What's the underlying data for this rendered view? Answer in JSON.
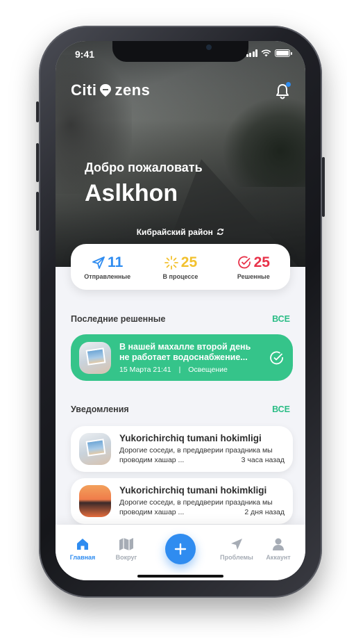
{
  "status": {
    "time": "9:41"
  },
  "header": {
    "logo_left": "Citi",
    "logo_right": "zens"
  },
  "hero": {
    "welcome": "Добро пожаловать",
    "username": "Aslkhon",
    "district": "Кибрайский район"
  },
  "stats": [
    {
      "value": "11",
      "label": "Отправленные",
      "color": "#2f8cf0",
      "icon": "paper-plane-icon"
    },
    {
      "value": "25",
      "label": "В процессе",
      "color": "#f2c12e",
      "icon": "loading-sun-icon"
    },
    {
      "value": "25",
      "label": "Решенные",
      "color": "#e8334a",
      "icon": "check-circle-icon"
    }
  ],
  "recent": {
    "title": "Последние решенные",
    "all": "ВСЕ",
    "card": {
      "title_line1": "В нашей махалле второй день",
      "title_line2": "не работает водоснабжение...",
      "date": "15 Марта 21:41",
      "separator": "|",
      "category": "Освещение"
    }
  },
  "notifications": {
    "title": "Уведомления",
    "all": "ВСЕ",
    "items": [
      {
        "title": "Yukorichirchiq tumani hokimligi",
        "line1": "Дорогие соседи, в преддверии праздника мы",
        "line2": "проводим хашар ...",
        "time": "3 часа назад"
      },
      {
        "title": "Yukorichirchiq tumani hokimkligi",
        "line1": "Дорогие соседи, в преддверии праздника мы",
        "line2": "проводим хашар ...",
        "time": "2 дня назад"
      }
    ]
  },
  "tabbar": {
    "home": "Главная",
    "around": "Вокруг",
    "problems": "Проблемы",
    "account": "Аккаунт"
  },
  "colors": {
    "accent": "#2f8cf0",
    "success": "#35c48a",
    "pending": "#f2c12e",
    "resolved": "#e8334a"
  }
}
